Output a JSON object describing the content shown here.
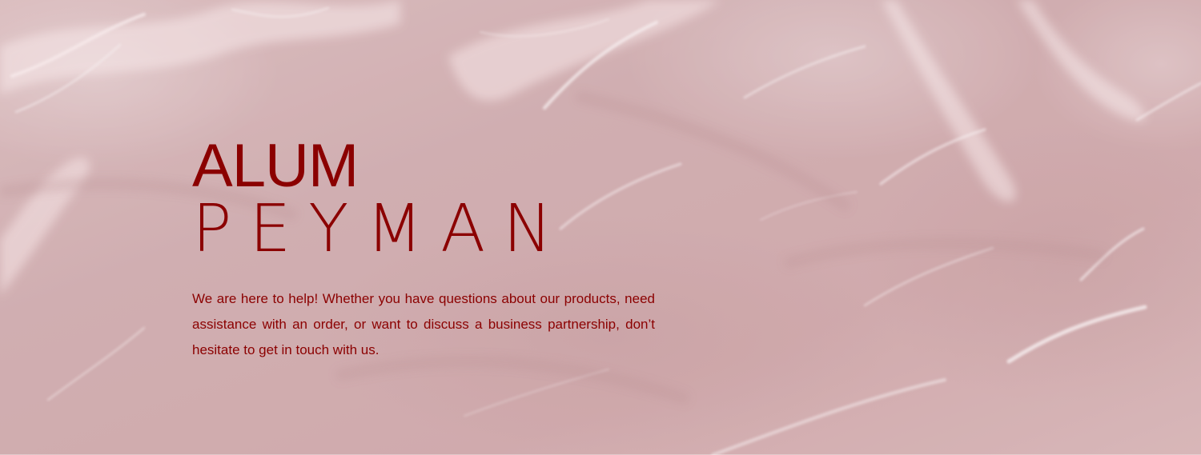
{
  "hero": {
    "brand_line_1": "ALUM",
    "brand_line_2": "PEYMAN",
    "description": "We are here to help! Whether you have questions about our products, need assistance with an order, or want to discuss a business partnership, don’t hesitate to get in touch with us."
  },
  "colors": {
    "text_accent": "#8b0000",
    "background_tint": "#cfabad",
    "highlight": "#f8ecec"
  }
}
